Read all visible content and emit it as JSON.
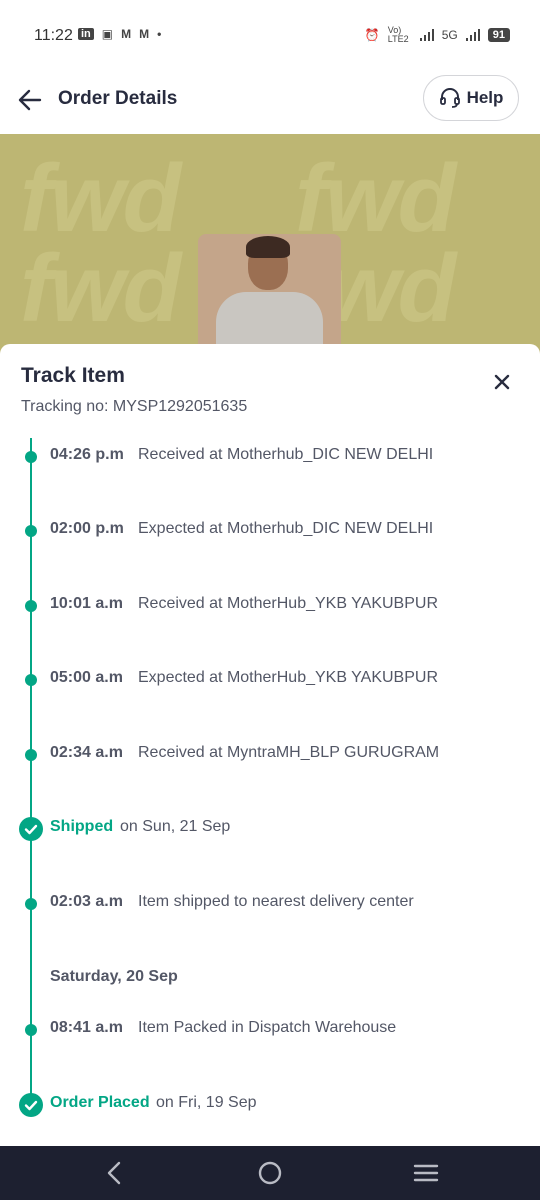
{
  "status_bar": {
    "time": "11:22",
    "left_icons": [
      "linkedin-icon",
      "image-icon",
      "myntra-icon",
      "myntra-icon",
      "dot-icon"
    ],
    "network_label": "Vo) LTE2",
    "network_type": "5G",
    "battery": "91"
  },
  "header": {
    "title": "Order Details",
    "help_label": "Help"
  },
  "banner": {
    "watermark_text": "fwd"
  },
  "sheet": {
    "title": "Track Item",
    "tracking": "Tracking no: MYSP1292051635",
    "events": [
      {
        "time": "04:26 p.m",
        "description": "Received at Motherhub_DIC NEW DELHI"
      },
      {
        "time": "02:00 p.m",
        "description": "Expected at Motherhub_DIC NEW DELHI"
      },
      {
        "time": "10:01 a.m",
        "description": "Received at MotherHub_YKB YAKUBPUR"
      },
      {
        "time": "05:00 a.m",
        "description": "Expected at MotherHub_YKB YAKUBPUR"
      },
      {
        "time": "02:34 a.m",
        "description": "Received at MyntraMH_BLP GURUGRAM"
      }
    ],
    "shipped": {
      "status": "Shipped",
      "date": "on Sun, 21 Sep"
    },
    "shipped_event": {
      "time": "02:03 a.m",
      "description": "Item shipped to nearest delivery center"
    },
    "day_header": "Saturday, 20 Sep",
    "packed_event": {
      "time": "08:41 a.m",
      "description": "Item Packed in Dispatch Warehouse"
    },
    "placed": {
      "status": "Order Placed",
      "date": "on Fri, 19 Sep"
    }
  },
  "colors": {
    "accent": "#03a685",
    "text_primary": "#282c3f",
    "text_secondary": "#535766",
    "nav_bar": "#1d2030"
  }
}
